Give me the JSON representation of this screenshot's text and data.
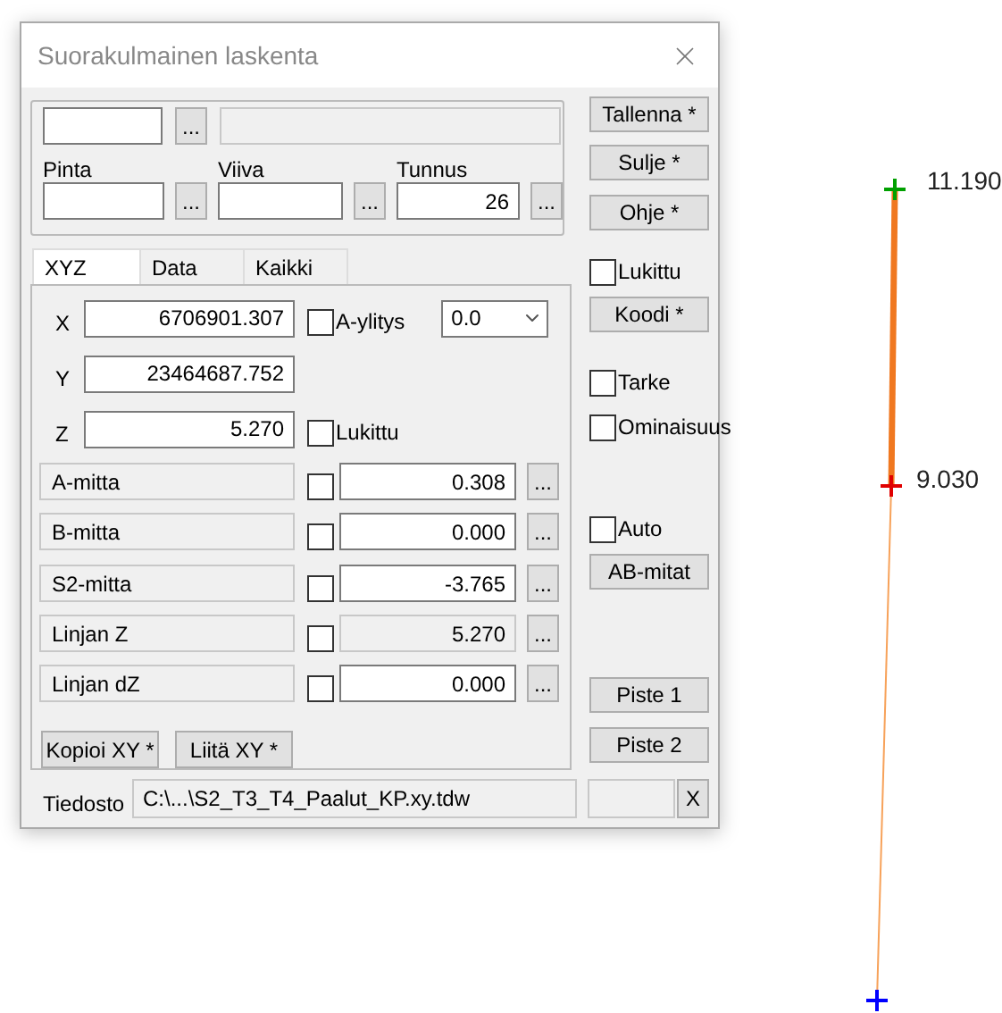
{
  "window": {
    "title": "Suorakulmainen laskenta"
  },
  "top_group": {
    "top_browse": "...",
    "fields": [
      {
        "label": "Pinta",
        "browse": "..."
      },
      {
        "label": "Viiva",
        "browse": "..."
      },
      {
        "label": "Tunnus",
        "value": "26",
        "browse": "..."
      }
    ]
  },
  "tabs": [
    {
      "label": "XYZ",
      "selected": true
    },
    {
      "label": "Data",
      "selected": false
    },
    {
      "label": "Kaikki",
      "selected": false
    }
  ],
  "coords": [
    {
      "label": "X",
      "value": "6706901.307"
    },
    {
      "label": "Y",
      "value": "23464687.752"
    },
    {
      "label": "Z",
      "value": "5.270"
    }
  ],
  "a_ylitys": {
    "label": "A-ylitys",
    "checked": false
  },
  "dropdown": {
    "value": "0.0"
  },
  "z_lock": {
    "label": "Lukittu",
    "checked": false
  },
  "measures": [
    {
      "label": "A-mitta",
      "checked": false,
      "value": "0.308",
      "disabled": false,
      "browse": "..."
    },
    {
      "label": "B-mitta",
      "checked": false,
      "value": "0.000",
      "disabled": false,
      "browse": "..."
    },
    {
      "label": "S2-mitta",
      "checked": false,
      "value": "-3.765",
      "disabled": false,
      "browse": "..."
    },
    {
      "label": "Linjan Z",
      "checked": false,
      "value": "5.270",
      "disabled": true,
      "browse": "..."
    },
    {
      "label": "Linjan dZ",
      "checked": false,
      "value": "0.000",
      "disabled": false,
      "browse": "..."
    }
  ],
  "bottom_buttons": [
    "Kopioi XY *",
    "Liitä XY *"
  ],
  "side": [
    {
      "kind": "button",
      "label": "Tallenna *"
    },
    {
      "kind": "button",
      "label": "Sulje *"
    },
    {
      "kind": "button",
      "label": "Ohje *"
    },
    {
      "kind": "checkbox",
      "label": "Lukittu",
      "checked": false
    },
    {
      "kind": "button",
      "label": "Koodi *"
    },
    {
      "kind": "checkbox",
      "label": "Tarke",
      "checked": false
    },
    {
      "kind": "checkbox",
      "label": "Ominaisuus",
      "checked": false
    },
    {
      "kind": "checkbox",
      "label": "Auto",
      "checked": false
    },
    {
      "kind": "button",
      "label": "AB-mitat"
    },
    {
      "kind": "button",
      "label": "Piste 1"
    },
    {
      "kind": "button",
      "label": "Piste 2"
    }
  ],
  "file": {
    "label": "Tiedosto",
    "value": "C:\\...\\S2_T3_T4_Paalut_KP.xy.tdw",
    "clear": "X"
  },
  "canvas": {
    "points": [
      {
        "label": "11.190",
        "color": "#00a000"
      },
      {
        "label": "9.030",
        "color": "#e00000"
      },
      {
        "color": "#0000ff"
      }
    ]
  }
}
